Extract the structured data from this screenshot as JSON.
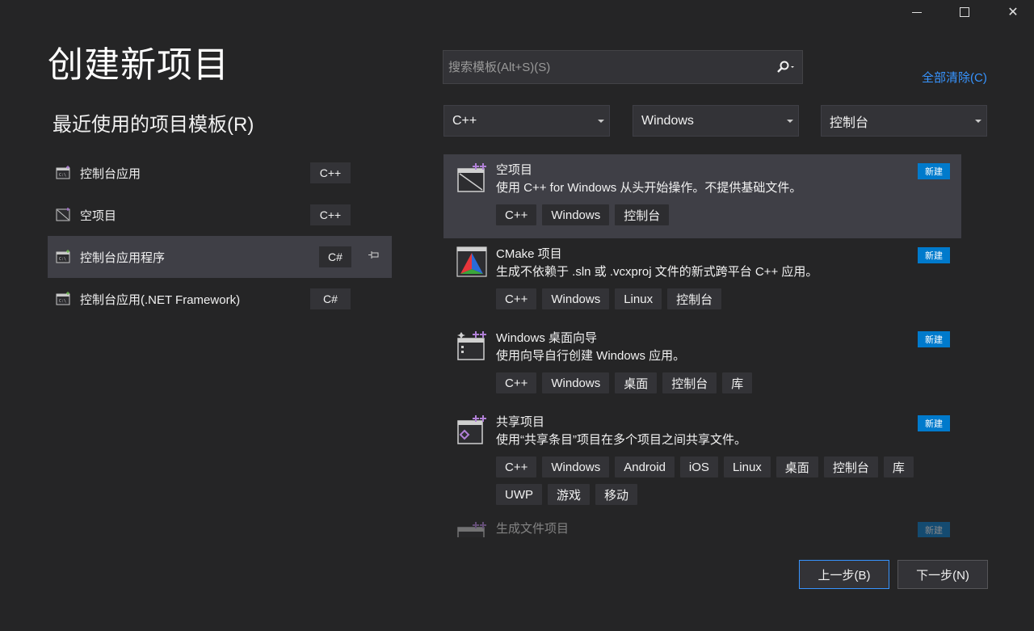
{
  "window": {
    "minimize_icon": "minimize-icon",
    "maximize_icon": "maximize-icon",
    "close_glyph": "✕"
  },
  "page_title": "创建新项目",
  "recent": {
    "title": "最近使用的项目模板(R)",
    "items": [
      {
        "label": "控制台应用",
        "lang": "C++"
      },
      {
        "label": "空项目",
        "lang": "C++"
      },
      {
        "label": "控制台应用程序",
        "lang": "C#",
        "pinned": true
      },
      {
        "label": "控制台应用(.NET Framework)",
        "lang": "C#"
      }
    ]
  },
  "search": {
    "placeholder": "搜索模板(Alt+S)(S)",
    "value": ""
  },
  "clear_all": "全部清除(C)",
  "filters": {
    "language": "C++",
    "platform": "Windows",
    "project_type": "控制台"
  },
  "templates": [
    {
      "name": "空项目",
      "desc": "使用 C++ for Windows 从头开始操作。不提供基础文件。",
      "badge": "新建",
      "tags": [
        "C++",
        "Windows",
        "控制台"
      ]
    },
    {
      "name": "CMake 项目",
      "desc": "生成不依赖于 .sln 或 .vcxproj 文件的新式跨平台 C++ 应用。",
      "badge": "新建",
      "tags": [
        "C++",
        "Windows",
        "Linux",
        "控制台"
      ]
    },
    {
      "name": "Windows 桌面向导",
      "desc": "使用向导自行创建 Windows 应用。",
      "badge": "新建",
      "tags": [
        "C++",
        "Windows",
        "桌面",
        "控制台",
        "库"
      ]
    },
    {
      "name": "共享项目",
      "desc": "使用“共享条目”项目在多个项目之间共享文件。",
      "badge": "新建",
      "tags": [
        "C++",
        "Windows",
        "Android",
        "iOS",
        "Linux",
        "桌面",
        "控制台",
        "库",
        "UWP",
        "游戏",
        "移动"
      ]
    },
    {
      "name": "生成文件项目",
      "desc": "",
      "badge": "新建",
      "tags": []
    }
  ],
  "buttons": {
    "back": "上一步(B)",
    "next": "下一步(N)"
  },
  "colors": {
    "background": "#252526",
    "accent": "#007acc",
    "link": "#3794ff",
    "selected": "#3f3f46",
    "icon_purple": "#b180d7"
  }
}
